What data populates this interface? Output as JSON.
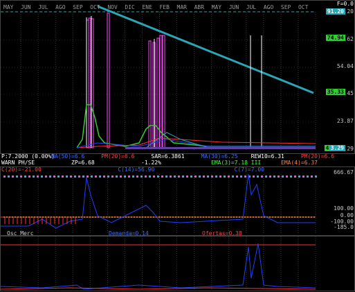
{
  "header": {
    "months": [
      "MAY",
      "JUN",
      "JUL",
      "AGO",
      "SEP",
      "OCT",
      "NOV",
      "DIC",
      "ENE",
      "FEB",
      "MAR",
      "ABR",
      "MAY",
      "JUN",
      "JUL",
      "AGO",
      "SEP",
      "OCT"
    ],
    "factor": "F=0.0"
  },
  "price_axis": {
    "labels": [
      "91.20",
      "71.62",
      "54.04",
      "35.45",
      "23.87",
      "8.29",
      "3.29"
    ],
    "tag_top": "91.20",
    "tag_mid1": "74.94",
    "tag_mid2": "35.33",
    "tag_low1": "4.7",
    "tag_low2": "3.29"
  },
  "indicators": {
    "row1": [
      {
        "text": "P:7.2000 (0.00%)",
        "color": "#ffffff"
      },
      {
        "text": "MA(50)=6.6",
        "color": "#3a6cff"
      },
      {
        "text": "PM(20)=6.6",
        "color": "#ff4040"
      },
      {
        "text": "SAR=6.3861",
        "color": "#ffffff"
      },
      {
        "text": "MA(30)=6.25",
        "color": "#3a6cff"
      },
      {
        "text": "REW10=6.31",
        "color": "#ffffff"
      },
      {
        "text": "PM(20)=6.6",
        "color": "#ff4040"
      }
    ],
    "row2": [
      {
        "text": "WARN PH/SE",
        "color": "#ffffff"
      },
      {
        "text": "ZP=6.68",
        "color": "#ffffff"
      },
      {
        "text": "-1.22%",
        "color": "#ffffff"
      },
      {
        "text": "EMA(3)=7.18 III",
        "color": "#40ff40"
      },
      {
        "text": "EMA(4)=6.37",
        "color": "#ff8040"
      }
    ],
    "row3": [
      {
        "text": "C(20)=-21.00",
        "color": "#ff4040"
      },
      {
        "text": "C(14)=56.90",
        "color": "#3a6cff"
      },
      {
        "text": "C(7)=7.00",
        "color": "#3a6cff"
      }
    ]
  },
  "oscillator": {
    "axis": [
      "666.67",
      "100.00",
      "0.00",
      "-100.00",
      "-185.0"
    ]
  },
  "ofertas_panel": {
    "title": "Osc Merc",
    "demanda": "Demanda=0.14",
    "ofertas": "Ofertas=0.38"
  },
  "colors": {
    "trendline": "#2aa6b6",
    "magenta": "#ff40ff",
    "green": "#33cc33",
    "blue": "#2040ff",
    "red": "#ff3030",
    "tag_green": "#33cc33"
  }
}
